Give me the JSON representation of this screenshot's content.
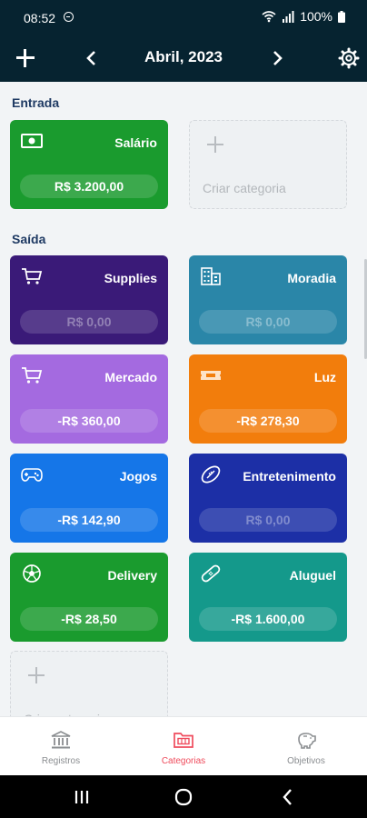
{
  "status_bar": {
    "time": "08:52",
    "battery": "100%"
  },
  "app_bar": {
    "month_title": "Abril, 2023"
  },
  "sections": {
    "income_title": "Entrada",
    "expense_title": "Saída"
  },
  "income": [
    {
      "name": "Salário",
      "value": "R$ 3.200,00",
      "color": "#1a9b2e",
      "icon": "money-icon"
    }
  ],
  "expenses": [
    {
      "name": "Supplies",
      "value": "R$ 0,00",
      "color": "#3a1a78",
      "icon": "cart-icon"
    },
    {
      "name": "Moradia",
      "value": "R$ 0,00",
      "color": "#2a86a8",
      "icon": "building-icon"
    },
    {
      "name": "Mercado",
      "value": "-R$ 360,00",
      "color": "#a46ae0",
      "icon": "cart-icon"
    },
    {
      "name": "Luz",
      "value": "-R$ 278,30",
      "color": "#f27d0c",
      "icon": "ticket-icon"
    },
    {
      "name": "Jogos",
      "value": "-R$ 142,90",
      "color": "#1576e8",
      "icon": "gamepad-icon"
    },
    {
      "name": "Entretenimento",
      "value": "R$ 0,00",
      "color": "#1c2fa6",
      "icon": "football-icon"
    },
    {
      "name": "Delivery",
      "value": "-R$ 28,50",
      "color": "#1a9b2e",
      "icon": "soccer-ball-icon"
    },
    {
      "name": "Aluguel",
      "value": "-R$ 1.600,00",
      "color": "#14998b",
      "icon": "bandage-icon"
    }
  ],
  "create_category_label": "Criar categoria",
  "bottom_nav": [
    {
      "label": "Registros",
      "icon": "bank-icon",
      "active": false
    },
    {
      "label": "Categorias",
      "icon": "folder-icon",
      "active": true
    },
    {
      "label": "Objetivos",
      "icon": "piggy-bank-icon",
      "active": false
    }
  ],
  "colors": {
    "header": "#062330",
    "accent": "#ef4b5c",
    "section_title": "#1f3a63"
  }
}
